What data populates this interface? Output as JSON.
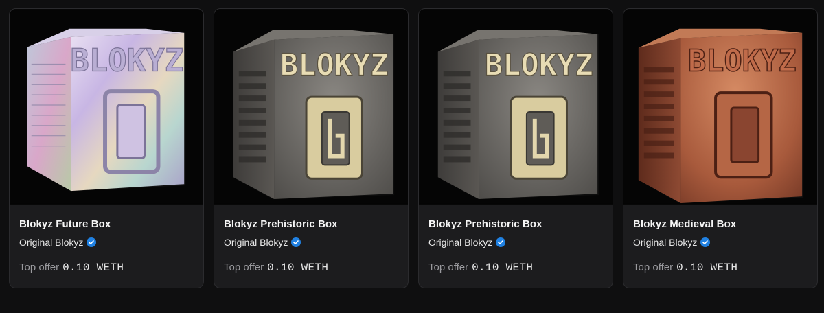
{
  "cards": [
    {
      "title": "Blokyz Future Box",
      "creator": "Original Blokyz",
      "offer_label": "Top offer",
      "offer_value": "0.10 WETH",
      "cube_text": "BLOKYZ",
      "finish": "holographic",
      "accent": "#c9b8e8"
    },
    {
      "title": "Blokyz Prehistoric Box",
      "creator": "Original Blokyz",
      "offer_label": "Top offer",
      "offer_value": "0.10 WETH",
      "cube_text": "BLOKYZ",
      "finish": "stone",
      "accent": "#6f6c68"
    },
    {
      "title": "Blokyz Prehistoric Box",
      "creator": "Original Blokyz",
      "offer_label": "Top offer",
      "offer_value": "0.10 WETH",
      "cube_text": "BLOKYZ",
      "finish": "stone",
      "accent": "#6f6c68"
    },
    {
      "title": "Blokyz Medieval Box",
      "creator": "Original Blokyz",
      "offer_label": "Top offer",
      "offer_value": "0.10 WETH",
      "cube_text": "BLOKYZ",
      "finish": "copper",
      "accent": "#b36a4c"
    }
  ],
  "verified_icon": "verified-badge-icon",
  "verified_color": "#2081e2"
}
